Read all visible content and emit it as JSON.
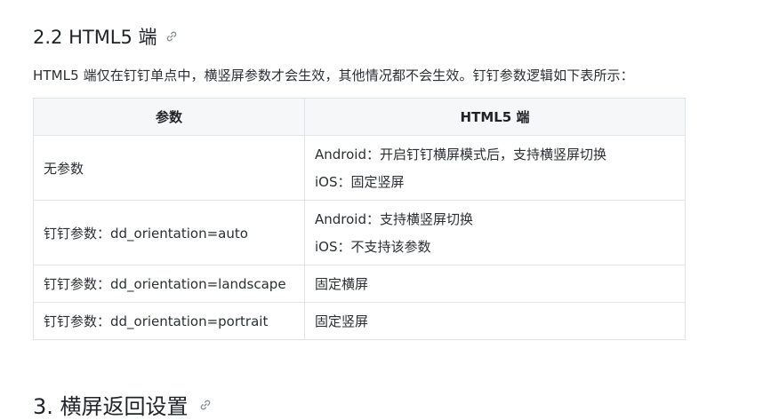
{
  "section": {
    "heading": "2.2 HTML5 端",
    "intro": "HTML5 端仅在钉钉单点中，横竖屏参数才会生效，其他情况都不会生效。钉钉参数逻辑如下表所示："
  },
  "table": {
    "headers": [
      "参数",
      "HTML5 端"
    ],
    "rows": [
      {
        "param": "无参数",
        "html5_line1": "Android：开启钉钉横屏模式后，支持横竖屏切换",
        "html5_line2": "iOS：固定竖屏"
      },
      {
        "param": "钉钉参数：dd_orientation=auto",
        "html5_line1": "Android：支持横竖屏切换",
        "html5_line2": "iOS：不支持该参数"
      },
      {
        "param": "钉钉参数：dd_orientation=landscape",
        "html5_line1": "固定横屏"
      },
      {
        "param": "钉钉参数：dd_orientation=portrait",
        "html5_line1": "固定竖屏"
      }
    ]
  },
  "next_section": {
    "heading": "3. 横屏返回设置"
  },
  "icons": {
    "anchor": "link-icon"
  },
  "colors": {
    "border": "#e1e4e8",
    "header_bg": "#f6f7f8",
    "icon": "#8a9099"
  }
}
